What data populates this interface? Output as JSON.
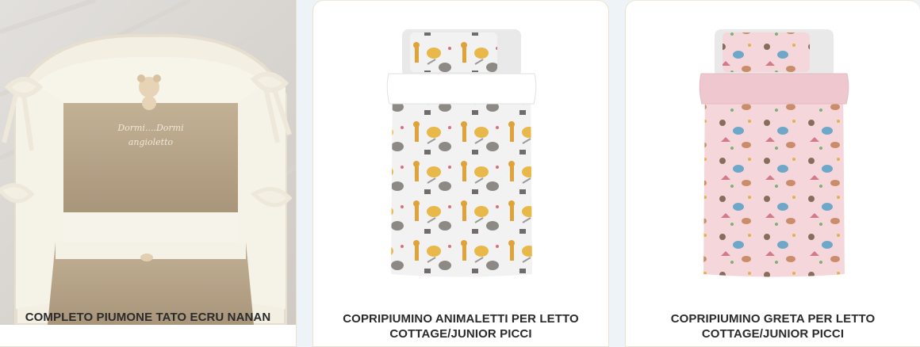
{
  "products": [
    {
      "title": "COMPLETO PIUMONE TATO ECRU NANAN",
      "embroidery_line1": "Dormi....Dormi",
      "embroidery_line2": "angioletto",
      "colors": {
        "linen": "#b8a58a",
        "cream": "#f4f1e6"
      }
    },
    {
      "title": "COPRIPIUMINO ANIMALETTI PER LETTO COTTAGE/JUNIOR PICCI",
      "colors": {
        "fabric": "#f1f1f1",
        "fold": "#ffffff"
      }
    },
    {
      "title": "COPRIPIUMINO GRETA PER LETTO COTTAGE/JUNIOR PICCI",
      "colors": {
        "fabric": "#f4d4d9",
        "fold": "#eec7cf"
      }
    }
  ]
}
